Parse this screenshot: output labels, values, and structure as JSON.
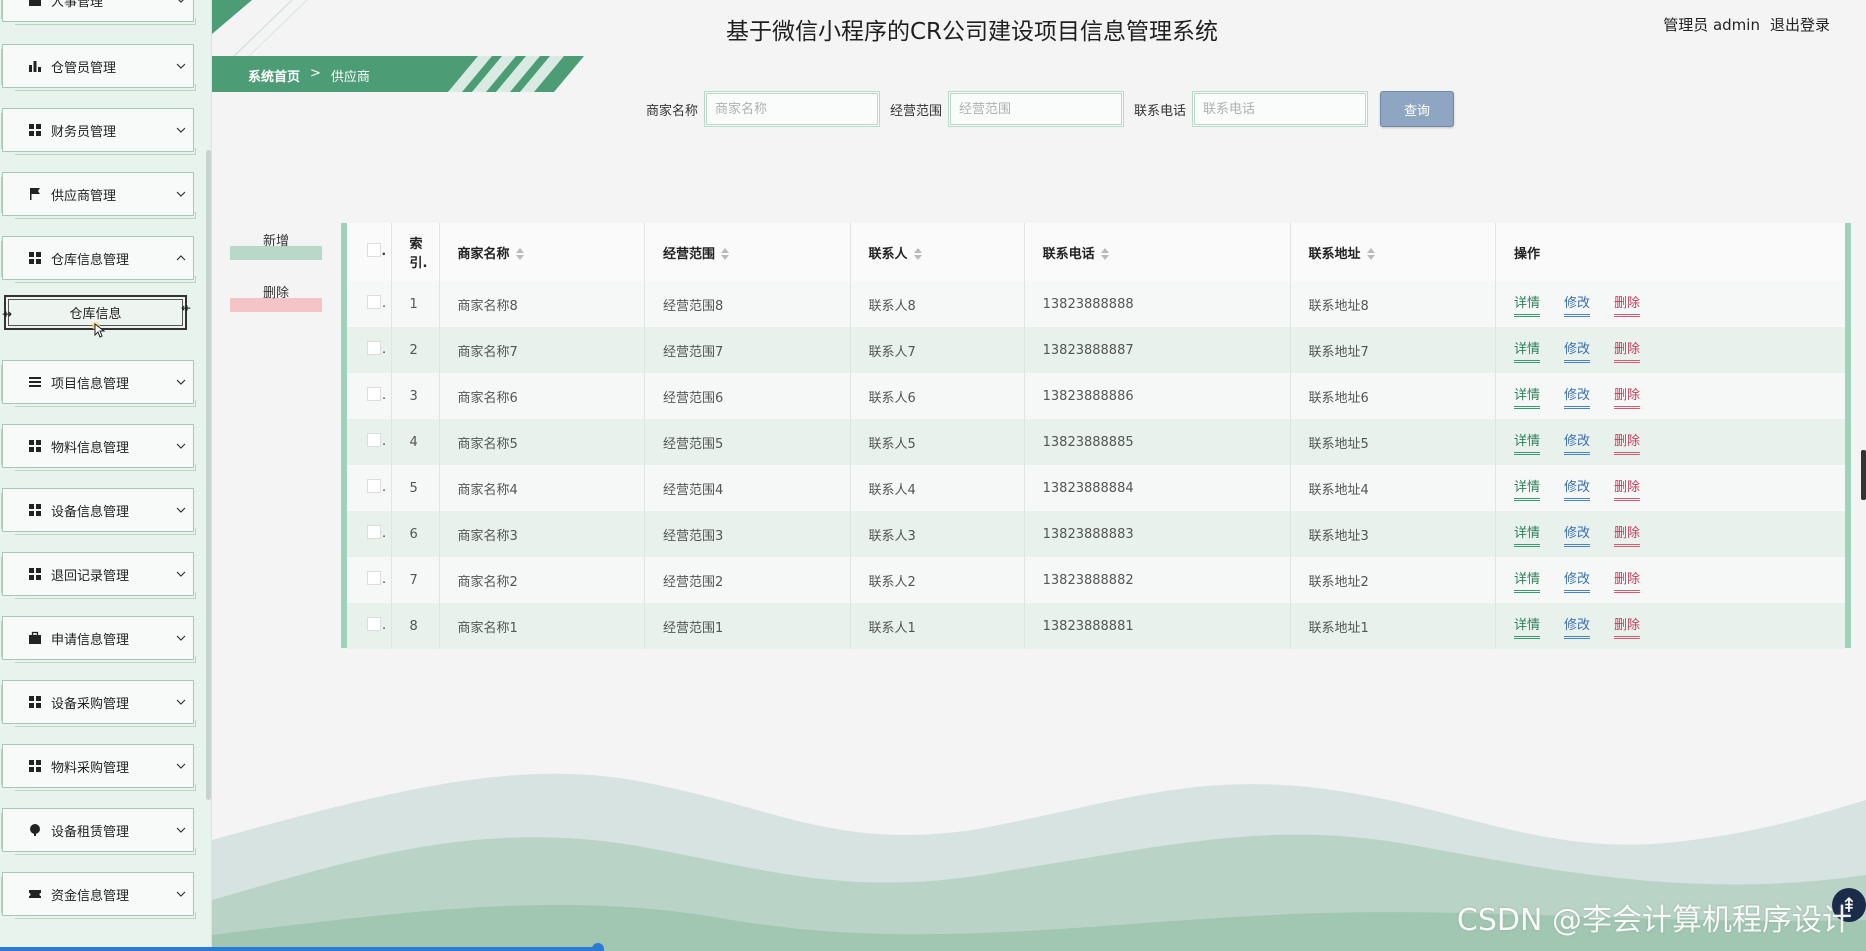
{
  "header": {
    "title": "基于微信小程序的CR公司建设项目信息管理系统",
    "user_text": "管理员 admin",
    "logout": "退出登录"
  },
  "breadcrumb": {
    "home": "系统首页",
    "separator": ">",
    "current": "供应商"
  },
  "sidebar": {
    "items": [
      {
        "label": "人事管理",
        "icon": "person-icon"
      },
      {
        "label": "仓管员管理",
        "icon": "bar-chart-icon"
      },
      {
        "label": "财务员管理",
        "icon": "grid-icon"
      },
      {
        "label": "供应商管理",
        "icon": "flag-icon"
      },
      {
        "label": "仓库信息管理",
        "icon": "grid-icon"
      },
      {
        "label": "项目信息管理",
        "icon": "list-icon"
      },
      {
        "label": "物料信息管理",
        "icon": "grid-icon"
      },
      {
        "label": "设备信息管理",
        "icon": "grid-icon"
      },
      {
        "label": "退回记录管理",
        "icon": "grid-icon"
      },
      {
        "label": "申请信息管理",
        "icon": "briefcase-icon"
      },
      {
        "label": "设备采购管理",
        "icon": "grid-icon"
      },
      {
        "label": "物料采购管理",
        "icon": "grid-icon"
      },
      {
        "label": "设备租赁管理",
        "icon": "pin-icon"
      },
      {
        "label": "资金信息管理",
        "icon": "ticket-icon"
      }
    ],
    "submenu_active": "仓库信息"
  },
  "search": {
    "label_1": "商家名称",
    "placeholder_1": "商家名称",
    "label_2": "经营范围",
    "placeholder_2": "经营范围",
    "label_3": "联系电话",
    "placeholder_3": "联系电话",
    "button": "查询"
  },
  "actions": {
    "add": "新增",
    "delete": "删除"
  },
  "table": {
    "headers": {
      "index": "索引.",
      "name": "商家名称",
      "scope": "经营范围",
      "contact": "联系人",
      "phone": "联系电话",
      "address": "联系地址",
      "ops": "操作"
    },
    "rows": [
      {
        "index": "1",
        "name": "商家名称8",
        "scope": "经营范围8",
        "contact": "联系人8",
        "phone": "13823888888",
        "address": "联系地址8"
      },
      {
        "index": "2",
        "name": "商家名称7",
        "scope": "经营范围7",
        "contact": "联系人7",
        "phone": "13823888887",
        "address": "联系地址7"
      },
      {
        "index": "3",
        "name": "商家名称6",
        "scope": "经营范围6",
        "contact": "联系人6",
        "phone": "13823888886",
        "address": "联系地址6"
      },
      {
        "index": "4",
        "name": "商家名称5",
        "scope": "经营范围5",
        "contact": "联系人5",
        "phone": "13823888885",
        "address": "联系地址5"
      },
      {
        "index": "5",
        "name": "商家名称4",
        "scope": "经营范围4",
        "contact": "联系人4",
        "phone": "13823888884",
        "address": "联系地址4"
      },
      {
        "index": "6",
        "name": "商家名称3",
        "scope": "经营范围3",
        "contact": "联系人3",
        "phone": "13823888883",
        "address": "联系地址3"
      },
      {
        "index": "7",
        "name": "商家名称2",
        "scope": "经营范围2",
        "contact": "联系人2",
        "phone": "13823888882",
        "address": "联系地址2"
      },
      {
        "index": "8",
        "name": "商家名称1",
        "scope": "经营范围1",
        "contact": "联系人1",
        "phone": "13823888881",
        "address": "联系地址1"
      }
    ],
    "op_detail": "详情",
    "op_edit": "修改",
    "op_delete": "删除"
  },
  "watermark": "CSDN @李会计算机程序设计",
  "colors": {
    "accent_green": "#4c9c76",
    "table_border": "#9fd2bb",
    "search_button": "#8ea6c1",
    "delete_red": "#c83a58",
    "edit_blue": "#3b6fb0"
  }
}
